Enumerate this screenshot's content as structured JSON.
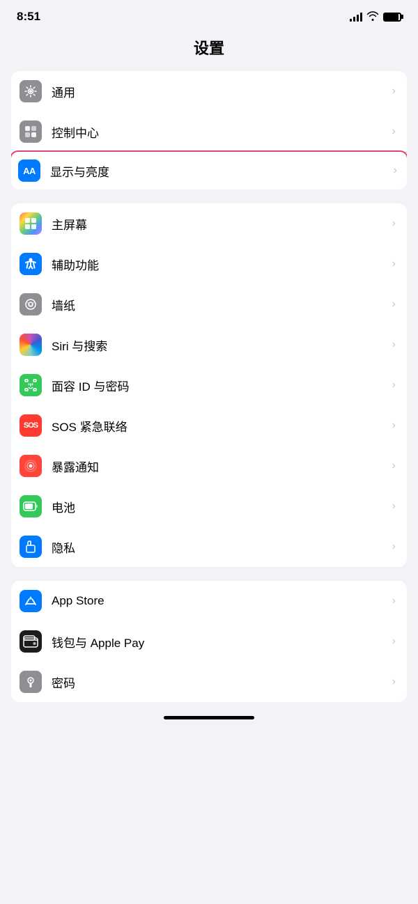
{
  "statusBar": {
    "time": "8:51"
  },
  "pageTitle": "设置",
  "group1": {
    "items": [
      {
        "id": "general",
        "label": "通用",
        "icon": "gear",
        "iconBg": "gray",
        "highlighted": false
      },
      {
        "id": "control-center",
        "label": "控制中心",
        "icon": "toggle",
        "iconBg": "gray",
        "highlighted": false
      },
      {
        "id": "display",
        "label": "显示与亮度",
        "icon": "AA",
        "iconBg": "blue-dark",
        "highlighted": true
      }
    ]
  },
  "group2": {
    "items": [
      {
        "id": "home-screen",
        "label": "主屏幕",
        "icon": "grid",
        "iconBg": "colorful",
        "highlighted": false
      },
      {
        "id": "accessibility",
        "label": "辅助功能",
        "icon": "person",
        "iconBg": "blue-light",
        "highlighted": false
      },
      {
        "id": "wallpaper",
        "label": "墙纸",
        "icon": "flower",
        "iconBg": "gray-flower",
        "highlighted": false
      },
      {
        "id": "siri",
        "label": "Siri 与搜索",
        "icon": "siri",
        "iconBg": "siri",
        "highlighted": false
      },
      {
        "id": "face-id",
        "label": "面容 ID 与密码",
        "icon": "face",
        "iconBg": "green",
        "highlighted": false
      },
      {
        "id": "sos",
        "label": "SOS 紧急联络",
        "icon": "SOS",
        "iconBg": "red",
        "highlighted": false
      },
      {
        "id": "exposure",
        "label": "暴露通知",
        "icon": "dot",
        "iconBg": "pink-dot",
        "highlighted": false
      },
      {
        "id": "battery",
        "label": "电池",
        "icon": "battery",
        "iconBg": "green-battery",
        "highlighted": false
      },
      {
        "id": "privacy",
        "label": "隐私",
        "icon": "hand",
        "iconBg": "blue-hand",
        "highlighted": false
      }
    ]
  },
  "group3": {
    "items": [
      {
        "id": "app-store",
        "label": "App Store",
        "icon": "A",
        "iconBg": "app-store",
        "highlighted": false
      },
      {
        "id": "wallet",
        "label": "钱包与 Apple Pay",
        "icon": "wallet",
        "iconBg": "wallet",
        "highlighted": false
      },
      {
        "id": "password",
        "label": "密码",
        "icon": "key",
        "iconBg": "password",
        "highlighted": false
      }
    ]
  },
  "chevron": "›"
}
